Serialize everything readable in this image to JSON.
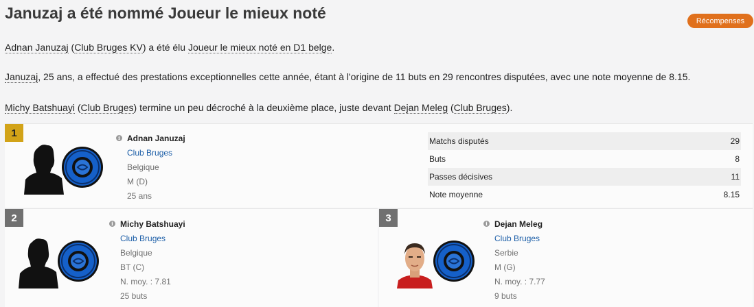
{
  "title": "Januzaj a été nommé Joueur le mieux noté",
  "award_button": "Récompenses",
  "para1": {
    "player": "Adnan Januzaj",
    "open": " (",
    "club": "Club Bruges KV",
    "mid": ") a été élu ",
    "award": "Joueur le mieux noté en D1 belge",
    "end": "."
  },
  "para2": {
    "player": "Januzaj",
    "text": ", 25 ans, a effectué des prestations exceptionnelles cette année, étant à l'origine de 11 buts en 29 rencontres disputées, avec une note moyenne de 8.15."
  },
  "para3": {
    "p2": "Michy Batshuayi",
    "o1": " (",
    "c2": "Club Bruges",
    "t1": ") termine un peu décroché à la deuxième place, juste devant ",
    "p3": "Dejan Meleg",
    "o2": " (",
    "c3": "Club Bruges",
    "t2": ")."
  },
  "first": {
    "rank": "1",
    "name": "Adnan Januzaj",
    "club": "Club Bruges",
    "nation": "Belgique",
    "position": "M (D)",
    "age": "25 ans",
    "stats": [
      {
        "label": "Matchs disputés",
        "value": "29"
      },
      {
        "label": "Buts",
        "value": "8"
      },
      {
        "label": "Passes décisives",
        "value": "11"
      },
      {
        "label": "Note moyenne",
        "value": "8.15"
      }
    ]
  },
  "second": {
    "rank": "2",
    "name": "Michy Batshuayi",
    "club": "Club Bruges",
    "nation": "Belgique",
    "position": "BT (C)",
    "rating": "N. moy. : 7.81",
    "goals": "25 buts"
  },
  "third": {
    "rank": "3",
    "name": "Dejan Meleg",
    "club": "Club Bruges",
    "nation": "Serbie",
    "position": "M (G)",
    "rating": "N. moy. : 7.77",
    "goals": "9 buts"
  },
  "colors": {
    "accent": "#e0701c",
    "gold": "#d2a318",
    "grey_rank": "#707070",
    "link": "#1d5fa8",
    "club_blue": "#1560c9"
  },
  "icons": [
    "info-icon",
    "player-silhouette-icon",
    "club-crest-icon",
    "player-photo"
  ]
}
